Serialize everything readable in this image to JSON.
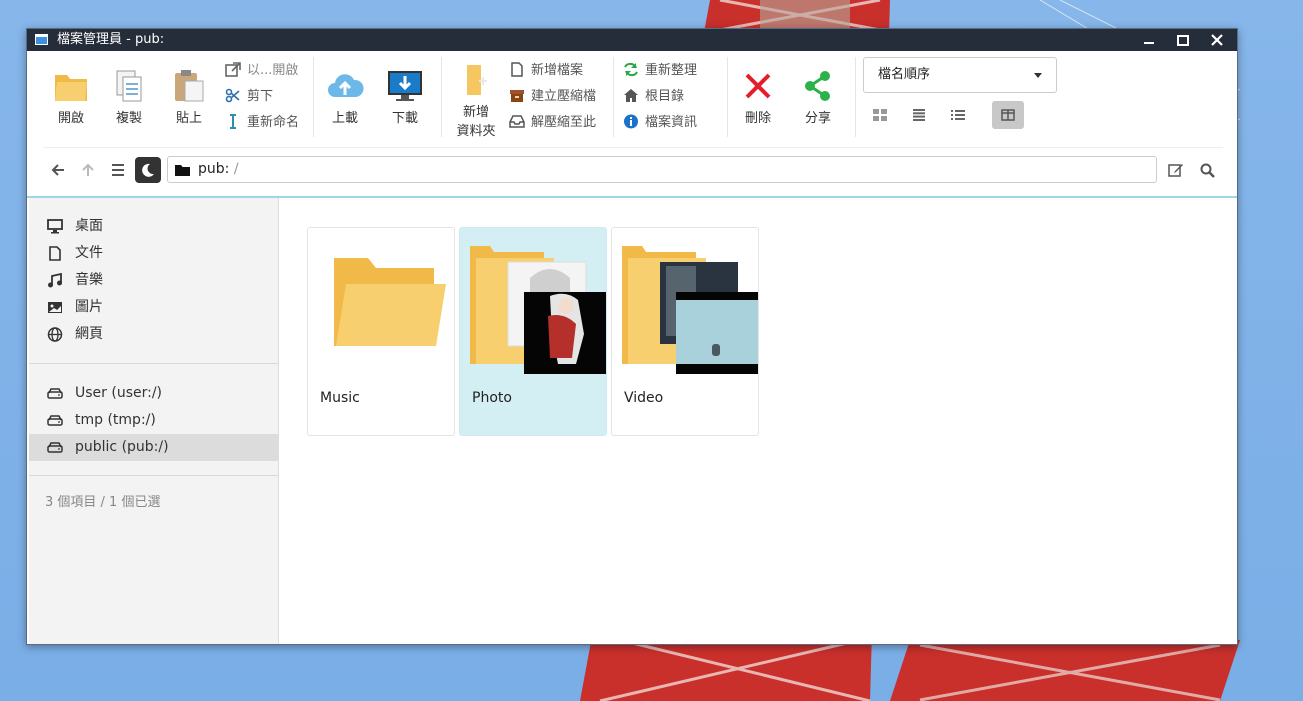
{
  "window": {
    "title": "檔案管理員 - pub:"
  },
  "toolbar": {
    "open": "開啟",
    "copy": "複製",
    "paste": "貼上",
    "open_with": "以...開啟",
    "cut": "剪下",
    "rename": "重新命名",
    "upload": "上載",
    "download": "下載",
    "new_folder_1": "新增",
    "new_folder_2": "資料夾",
    "new_file": "新增檔案",
    "create_archive": "建立壓縮檔",
    "extract_here": "解壓縮至此",
    "refresh": "重新整理",
    "root": "根目錄",
    "file_info": "檔案資訊",
    "delete": "刪除",
    "share": "分享",
    "sort_value": "檔名順序"
  },
  "address": {
    "path": "pub:",
    "slash": "/"
  },
  "sidebar": {
    "places": [
      {
        "label": "桌面",
        "icon": "monitor-icon"
      },
      {
        "label": "文件",
        "icon": "document-icon"
      },
      {
        "label": "音樂",
        "icon": "music-icon"
      },
      {
        "label": "圖片",
        "icon": "image-icon"
      },
      {
        "label": "網頁",
        "icon": "globe-icon"
      }
    ],
    "drives": [
      {
        "label": "User (user:/)",
        "icon": "drive-icon"
      },
      {
        "label": "tmp (tmp:/)",
        "icon": "drive-icon"
      },
      {
        "label": "public (pub:/)",
        "icon": "drive-icon",
        "selected": true
      }
    ],
    "status": "3 個項目 / 1 個已選"
  },
  "files": [
    {
      "name": "Music",
      "selected": false
    },
    {
      "name": "Photo",
      "selected": true
    },
    {
      "name": "Video",
      "selected": false
    }
  ],
  "colors": {
    "accent": "#9ed6e8",
    "selection": "#d3eff4",
    "folder": "#f6c761",
    "titlebar": "#252d3a"
  }
}
